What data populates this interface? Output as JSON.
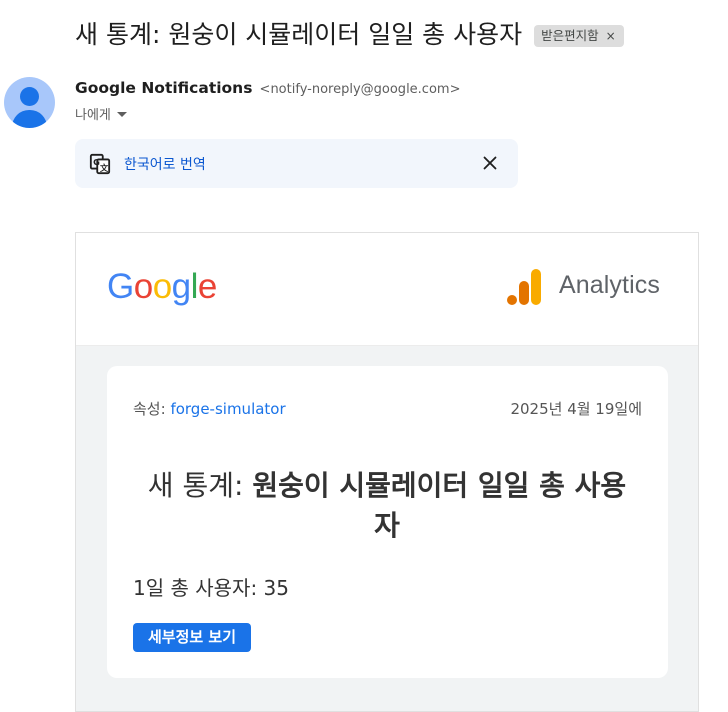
{
  "email": {
    "subject": "새 통계: 원숭이 시뮬레이터 일일 총 사용자",
    "label": "받은편지함",
    "label_remove": "×",
    "sender_name": "Google Notifications",
    "sender_email": "<notify-noreply@google.com>",
    "recipient": "나에게"
  },
  "translate": {
    "link_text": "한국어로 번역",
    "icon": "translate-icon",
    "close_icon": "close-icon"
  },
  "body": {
    "logo_text": [
      "G",
      "o",
      "o",
      "g",
      "l",
      "e"
    ],
    "logo_colors": [
      "#4285F4",
      "#EA4335",
      "#FBBC05",
      "#4285F4",
      "#34A853",
      "#EA4335"
    ],
    "product_name": "Analytics",
    "property_label": "속성: ",
    "property_value": "forge-simulator",
    "date": "2025년 4월 19일에",
    "headline_prefix": "새 통계: ",
    "headline_bold": "원숭이 시뮬레이터 일일 총 사용자",
    "metric_text": "1일 총 사용자: 35",
    "button_label": "세부정보 보기"
  },
  "colors": {
    "link_blue": "#0b57d0",
    "button_blue": "#1a73e8",
    "ga_orange_dark": "#E37400",
    "ga_orange_light": "#F9AB00",
    "avatar_bg": "#a8c7fa"
  }
}
